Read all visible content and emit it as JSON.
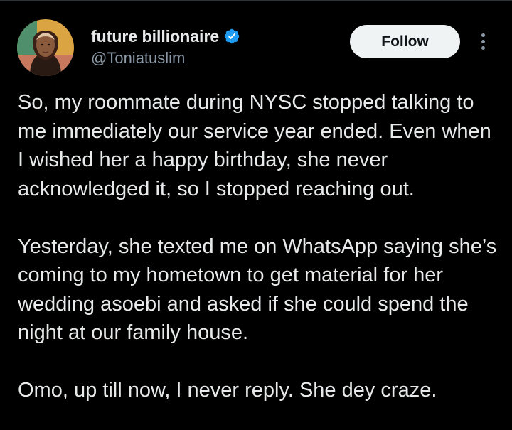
{
  "user": {
    "display_name": "future billionaire",
    "handle": "@Toniatuslim",
    "verified": true,
    "avatar_icon": "avatar-photo"
  },
  "header": {
    "follow_label": "Follow",
    "more_icon": "more-vertical-icon"
  },
  "tweet": {
    "paragraphs": [
      "So, my roommate during NYSC stopped talking to me immediately our service year ended. Even when I wished her a happy birthday, she never acknowledged it, so I stopped reaching out.",
      "Yesterday, she texted me on WhatsApp saying she’s coming to my hometown to get material for her wedding asoebi and asked if she could spend the night at our family house.",
      "Omo, up till now, I never reply. She dey craze."
    ]
  },
  "colors": {
    "background": "#000000",
    "text": "#e7e9ea",
    "secondary_text": "#8b98a5",
    "verified_blue": "#1d9bf0",
    "follow_bg": "#eff3f4"
  }
}
